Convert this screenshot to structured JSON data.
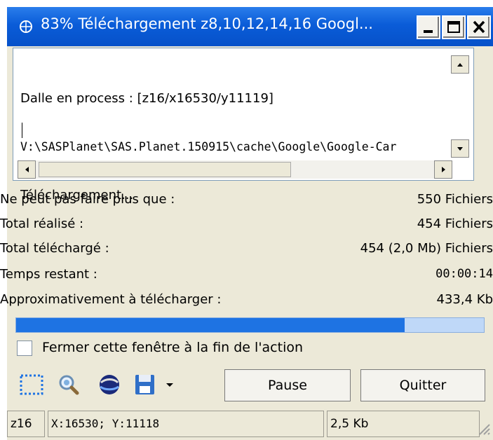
{
  "window": {
    "title": "83% Téléchargement z8,10,12,14,16 Googl..."
  },
  "log": {
    "line1": "Dalle en process : [z16/x16530/y11119]",
    "line2": "V:\\SASPlanet\\SAS.Planet.150915\\cache\\Google\\Google-Car",
    "line3": "Téléchargement..."
  },
  "stats": [
    {
      "label": "Ne peut pas faire plus que :",
      "value": "550 Fichiers"
    },
    {
      "label": "Total réalisé :",
      "value": "454 Fichiers"
    },
    {
      "label": "Total téléchargé :",
      "value": "454 (2,0 Mb) Fichiers"
    },
    {
      "label": "Temps restant :",
      "value": "00:00:14"
    },
    {
      "label": "Approximativement à télécharger :",
      "value": "433,4 Kb"
    }
  ],
  "progress": {
    "fraction": 0.83
  },
  "close_on_finish": {
    "label": "Fermer cette fenêtre à la fin de l'action",
    "checked": false
  },
  "toolbar": {
    "icons": [
      "selection-rect-icon",
      "zoom-magnifier-icon",
      "globe-icon",
      "save-disk-icon",
      "dropdown-arrow-icon"
    ],
    "pause_label": "Pause",
    "quit_label": "Quitter"
  },
  "statusbar": {
    "zoom": "z16",
    "coords": "X:16530; Y:11118",
    "size": "2,5 Kb"
  },
  "colors": {
    "titlebar": "#0A5CD8",
    "progress_fill": "#1E73E3",
    "progress_track": "#BFD8F8",
    "window_bg": "#ECE9D8"
  }
}
